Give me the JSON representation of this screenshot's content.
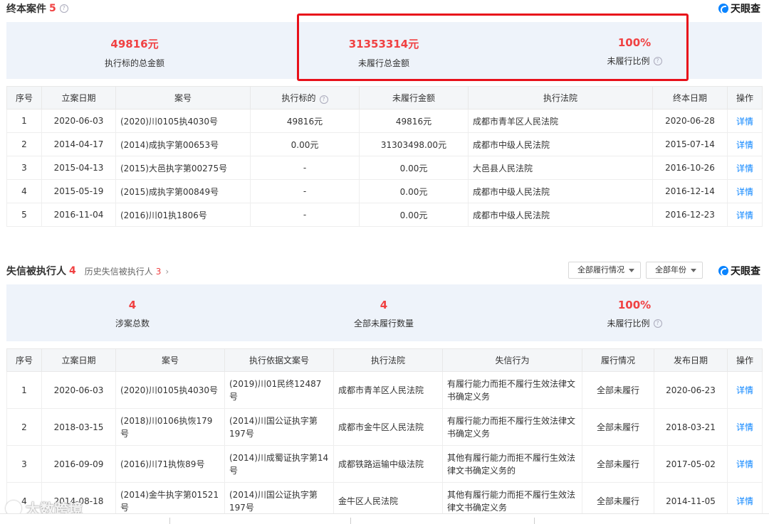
{
  "brand": {
    "name": "天眼查"
  },
  "section1": {
    "title": "终本案件",
    "count": "5",
    "stats": [
      {
        "value": "49816元",
        "label": "执行标的总金额"
      },
      {
        "value": "31353314元",
        "label": "未履行总金额"
      },
      {
        "value": "100%",
        "label": "未履行比例"
      }
    ],
    "headers": [
      "序号",
      "立案日期",
      "案号",
      "执行标的",
      "未履行金额",
      "执行法院",
      "终本日期",
      "操作"
    ],
    "rows": [
      {
        "no": "1",
        "date": "2020-06-03",
        "case": "(2020)川0105执4030号",
        "target": "49816元",
        "unpaid": "49816元",
        "court": "成都市青羊区人民法院",
        "end": "2020-06-28",
        "action": "详情"
      },
      {
        "no": "2",
        "date": "2014-04-17",
        "case": "(2014)成执字第00653号",
        "target": "0.00元",
        "unpaid": "31303498.00元",
        "court": "成都市中级人民法院",
        "end": "2015-07-14",
        "action": "详情"
      },
      {
        "no": "3",
        "date": "2015-04-13",
        "case": "(2015)大邑执字第00275号",
        "target": "-",
        "unpaid": "0.00元",
        "court": "大邑县人民法院",
        "end": "2016-10-26",
        "action": "详情"
      },
      {
        "no": "4",
        "date": "2015-05-19",
        "case": "(2015)成执字第00849号",
        "target": "-",
        "unpaid": "0.00元",
        "court": "成都市中级人民法院",
        "end": "2016-12-14",
        "action": "详情"
      },
      {
        "no": "5",
        "date": "2016-11-04",
        "case": "(2016)川01执1806号",
        "target": "-",
        "unpaid": "0.00元",
        "court": "成都市中级人民法院",
        "end": "2016-12-23",
        "action": "详情"
      }
    ]
  },
  "section2": {
    "title": "失信被执行人",
    "count": "4",
    "history_label": "历史失信被执行人",
    "history_count": "3",
    "filters": {
      "status": "全部履行情况",
      "year": "全部年份"
    },
    "stats": [
      {
        "value": "4",
        "label": "涉案总数"
      },
      {
        "value": "4",
        "label": "全部未履行数量"
      },
      {
        "value": "100%",
        "label": "未履行比例"
      }
    ],
    "headers": [
      "序号",
      "立案日期",
      "案号",
      "执行依据文案号",
      "执行法院",
      "失信行为",
      "履行情况",
      "发布日期",
      "操作"
    ],
    "rows": [
      {
        "no": "1",
        "date": "2020-06-03",
        "case": "(2020)川0105执4030号",
        "basis": "(2019)川01民终12487号",
        "court": "成都市青羊区人民法院",
        "behavior": "有履行能力而拒不履行生效法律文书确定义务",
        "status": "全部未履行",
        "pub": "2020-06-23",
        "action": "详情"
      },
      {
        "no": "2",
        "date": "2018-03-15",
        "case": "(2018)川0106执恢179号",
        "basis": "(2014)川国公证执字第197号",
        "court": "成都市金牛区人民法院",
        "behavior": "有履行能力而拒不履行生效法律文书确定义务",
        "status": "全部未履行",
        "pub": "2018-03-21",
        "action": "详情"
      },
      {
        "no": "3",
        "date": "2016-09-09",
        "case": "(2016)川71执恢89号",
        "basis": "(2014)川成蜀证执字第14号",
        "court": "成都铁路运输中级法院",
        "behavior": "其他有履行能力而拒不履行生效法律文书确定义务的",
        "status": "全部未履行",
        "pub": "2017-05-02",
        "action": "详情"
      },
      {
        "no": "4",
        "date": "2014-08-18",
        "case": "(2014)金牛执字第01521号",
        "basis": "(2014)川国公证执字第197号",
        "court": "金牛区人民法院",
        "behavior": "其他有履行能力而拒不履行生效法律文书确定义务",
        "status": "全部未履行",
        "pub": "2014-11-05",
        "action": "详情"
      }
    ]
  },
  "watermark": {
    "text": "大数跨境"
  }
}
